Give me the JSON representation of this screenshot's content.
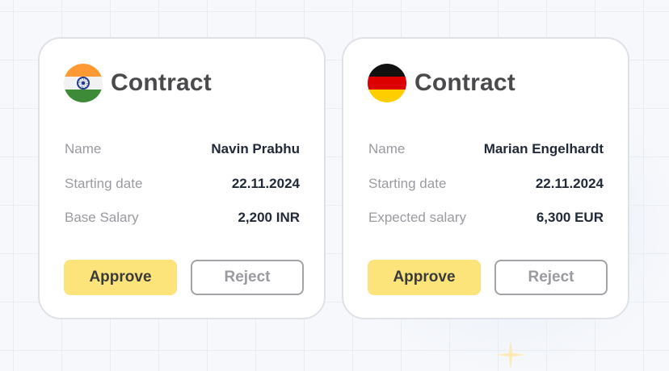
{
  "colors": {
    "approve_bg": "#fde47a",
    "reject_border": "#a4a4a8",
    "label_text": "#9a9aa0",
    "value_text": "#1f2937",
    "title_text": "#4a4a4d"
  },
  "cards": [
    {
      "flag_icon": "india-flag-icon",
      "flag_colors": [
        "#ff9933",
        "#f2f2f2",
        "#3d8b37"
      ],
      "title": "Contract",
      "rows": [
        {
          "label": "Name",
          "value": "Navin Prabhu"
        },
        {
          "label": "Starting date",
          "value": "22.11.2024"
        },
        {
          "label": "Base Salary",
          "value": "2,200 INR"
        }
      ],
      "approve_label": "Approve",
      "reject_label": "Reject"
    },
    {
      "flag_icon": "germany-flag-icon",
      "flag_colors": [
        "#111111",
        "#dd0000",
        "#ffce00"
      ],
      "title": "Contract",
      "rows": [
        {
          "label": "Name",
          "value": "Marian Engelhardt"
        },
        {
          "label": "Starting date",
          "value": "22.11.2024"
        },
        {
          "label": "Expected salary",
          "value": "6,300 EUR"
        }
      ],
      "approve_label": "Approve",
      "reject_label": "Reject"
    }
  ]
}
